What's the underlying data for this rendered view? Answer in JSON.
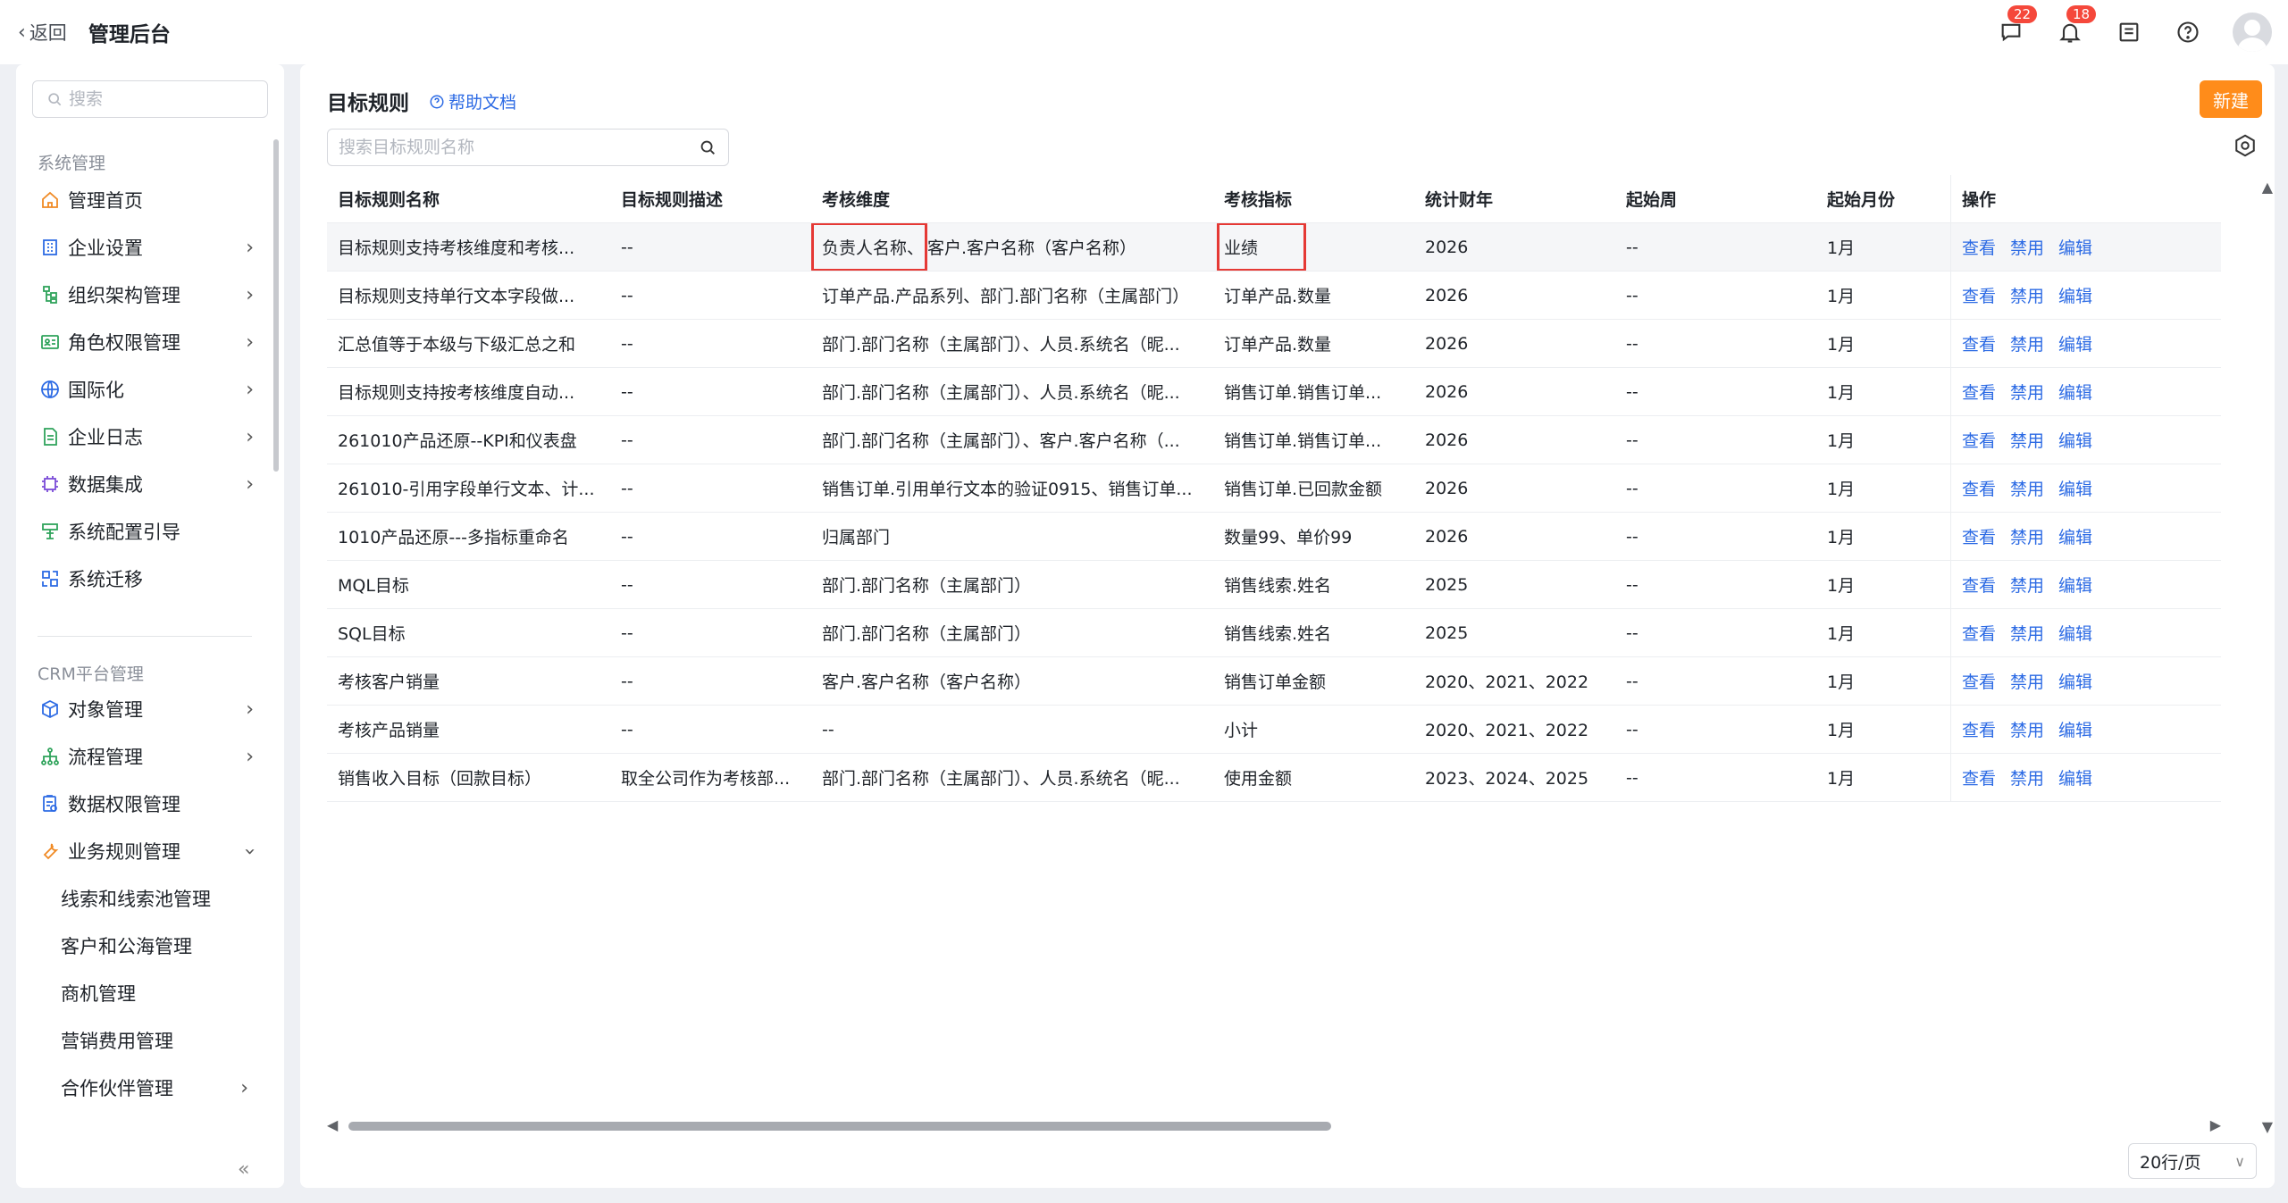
{
  "topbar": {
    "back_label": "返回",
    "app_title": "管理后台",
    "messages_count": "22",
    "notifications_count": "18"
  },
  "sidebar": {
    "search_placeholder": "搜索",
    "group_system": "系统管理",
    "system_items": [
      {
        "label": "管理首页",
        "icon": "home-icon"
      },
      {
        "label": "企业设置",
        "icon": "building-icon"
      },
      {
        "label": "组织架构管理",
        "icon": "org-icon"
      },
      {
        "label": "角色权限管理",
        "icon": "role-icon"
      },
      {
        "label": "国际化",
        "icon": "globe-icon"
      },
      {
        "label": "企业日志",
        "icon": "log-icon"
      },
      {
        "label": "数据集成",
        "icon": "chip-icon"
      },
      {
        "label": "系统配置引导",
        "icon": "guide-icon"
      },
      {
        "label": "系统迁移",
        "icon": "migrate-icon"
      }
    ],
    "group_crm": "CRM平台管理",
    "crm_items": [
      {
        "label": "对象管理",
        "icon": "cube-icon"
      },
      {
        "label": "流程管理",
        "icon": "flow-icon"
      },
      {
        "label": "数据权限管理",
        "icon": "data-permission-icon"
      },
      {
        "label": "业务规则管理",
        "icon": "wrench-icon"
      }
    ],
    "sub_items": [
      "线索和线索池管理",
      "客户和公海管理",
      "商机管理",
      "营销费用管理",
      "合作伙伴管理"
    ]
  },
  "main": {
    "title": "目标规则",
    "help_label": "帮助文档",
    "new_button": "新建",
    "search_placeholder": "搜索目标规则名称",
    "columns": [
      "目标规则名称",
      "目标规则描述",
      "考核维度",
      "考核指标",
      "统计财年",
      "起始周",
      "起始月份",
      "操作"
    ],
    "actions": {
      "view": "查看",
      "disable": "禁用",
      "edit": "编辑"
    },
    "rows": [
      {
        "name": "目标规则支持考核维度和考核...",
        "desc": "--",
        "dimension_a": "负责人名称、",
        "dimension_b": "客户.客户名称（客户名称）",
        "metric": "业绩",
        "fiscal_year": "2026",
        "start_week": "--",
        "start_month": "1月"
      },
      {
        "name": "目标规则支持单行文本字段做...",
        "desc": "--",
        "dimension_a": "订单产品.产品系列、部门.部门名称（主属部门）",
        "dimension_b": "",
        "metric": "订单产品.数量",
        "fiscal_year": "2026",
        "start_week": "--",
        "start_month": "1月"
      },
      {
        "name": "汇总值等于本级与下级汇总之和",
        "desc": "--",
        "dimension_a": "部门.部门名称（主属部门）、人员.系统名（昵...",
        "dimension_b": "",
        "metric": "订单产品.数量",
        "fiscal_year": "2026",
        "start_week": "--",
        "start_month": "1月"
      },
      {
        "name": "目标规则支持按考核维度自动...",
        "desc": "--",
        "dimension_a": "部门.部门名称（主属部门）、人员.系统名（昵...",
        "dimension_b": "",
        "metric": "销售订单.销售订单...",
        "fiscal_year": "2026",
        "start_week": "--",
        "start_month": "1月"
      },
      {
        "name": "261010产品还原--KPI和仪表盘",
        "desc": "--",
        "dimension_a": "部门.部门名称（主属部门）、客户.客户名称（...",
        "dimension_b": "",
        "metric": "销售订单.销售订单...",
        "fiscal_year": "2026",
        "start_week": "--",
        "start_month": "1月"
      },
      {
        "name": "261010-引用字段单行文本、计...",
        "desc": "--",
        "dimension_a": "销售订单.引用单行文本的验证0915、销售订单...",
        "dimension_b": "",
        "metric": "销售订单.已回款金额",
        "fiscal_year": "2026",
        "start_week": "--",
        "start_month": "1月"
      },
      {
        "name": "1010产品还原---多指标重命名",
        "desc": "--",
        "dimension_a": "归属部门",
        "dimension_b": "",
        "metric": "数量99、单价99",
        "fiscal_year": "2026",
        "start_week": "--",
        "start_month": "1月"
      },
      {
        "name": "MQL目标",
        "desc": "--",
        "dimension_a": "部门.部门名称（主属部门）",
        "dimension_b": "",
        "metric": "销售线索.姓名",
        "fiscal_year": "2025",
        "start_week": "--",
        "start_month": "1月"
      },
      {
        "name": "SQL目标",
        "desc": "--",
        "dimension_a": "部门.部门名称（主属部门）",
        "dimension_b": "",
        "metric": "销售线索.姓名",
        "fiscal_year": "2025",
        "start_week": "--",
        "start_month": "1月"
      },
      {
        "name": "考核客户销量",
        "desc": "--",
        "dimension_a": "客户.客户名称（客户名称）",
        "dimension_b": "",
        "metric": "销售订单金额",
        "fiscal_year": "2020、2021、2022",
        "start_week": "--",
        "start_month": "1月"
      },
      {
        "name": "考核产品销量",
        "desc": "--",
        "dimension_a": "--",
        "dimension_b": "",
        "metric": "小计",
        "fiscal_year": "2020、2021、2022",
        "start_week": "--",
        "start_month": "1月"
      },
      {
        "name": "销售收入目标（回款目标）",
        "desc": "取全公司作为考核部...",
        "dimension_a": "部门.部门名称（主属部门）、人员.系统名（昵...",
        "dimension_b": "",
        "metric": "使用金额",
        "fiscal_year": "2023、2024、2025",
        "start_week": "--",
        "start_month": "1月"
      }
    ],
    "page_size_label": "20行/页"
  },
  "colors": {
    "accent_blue": "#2d6be4",
    "new_button_orange": "#ff8c1a",
    "highlight_red": "#e53935",
    "badge_red": "#f5483b"
  }
}
